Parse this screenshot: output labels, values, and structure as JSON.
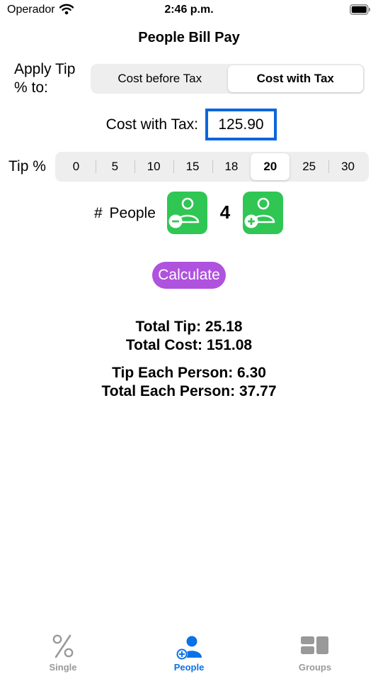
{
  "status_bar": {
    "carrier": "Operador",
    "time": "2:46 p.m."
  },
  "nav": {
    "title": "People Bill Pay"
  },
  "apply_tip": {
    "label": "Apply Tip % to:",
    "options": [
      "Cost before Tax",
      "Cost with Tax"
    ],
    "selected_index": 1
  },
  "cost": {
    "label": "Cost with Tax:",
    "value": "125.90"
  },
  "tip": {
    "label": "Tip %",
    "options": [
      "0",
      "5",
      "10",
      "15",
      "18",
      "20",
      "25",
      "30"
    ],
    "selected_index": 5
  },
  "people": {
    "label": "# People",
    "count": "4"
  },
  "calculate_label": "Calculate",
  "results": {
    "total_tip": "Total Tip: 25.18",
    "total_cost": "Total Cost: 151.08",
    "tip_each": "Tip Each Person: 6.30",
    "total_each": "Total Each Person: 37.77"
  },
  "tabs": [
    {
      "label": "Single",
      "icon": "percent-icon"
    },
    {
      "label": "People",
      "icon": "person-add-icon"
    },
    {
      "label": "Groups",
      "icon": "groups-icon"
    }
  ],
  "active_tab_index": 1,
  "colors": {
    "accent": "#0a72e6",
    "input_border": "#0a66dd",
    "people_button": "#2fc653",
    "calculate_button": "#af52de",
    "inactive_tab": "#999999"
  }
}
